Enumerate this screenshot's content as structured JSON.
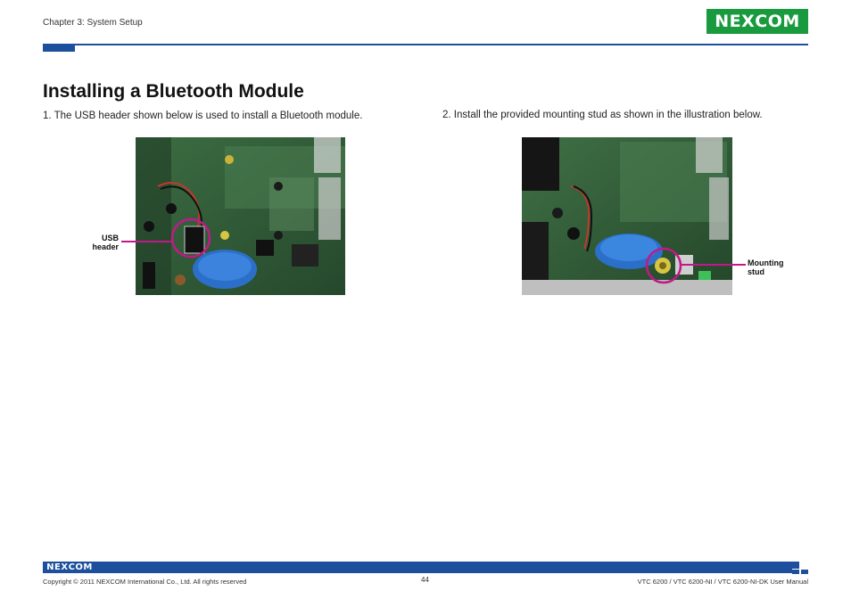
{
  "header": {
    "chapter": "Chapter 3: System Setup",
    "logo_text_a": "NE",
    "logo_text_x": "X",
    "logo_text_b": "COM",
    "brand_green": "#1a9a3e",
    "rule_color": "#1c4f9c"
  },
  "main": {
    "title": "Installing a Bluetooth Module",
    "step1": "1.  The USB header shown below is used to install a Bluetooth module.",
    "step2": "2.  Install the provided mounting stud as shown in the illustration below.",
    "callout1_line1": "USB",
    "callout1_line2": "header",
    "callout2_line1": "Mounting",
    "callout2_line2": "stud",
    "callout_color": "#c2188b"
  },
  "footer": {
    "logo_text_a": "NE",
    "logo_text_x": "X",
    "logo_text_b": "COM",
    "copyright": "Copyright © 2011 NEXCOM International Co., Ltd. All rights reserved",
    "page_number": "44",
    "manual_title": "VTC 6200 / VTC 6200-NI / VTC 6200-NI-DK User Manual"
  }
}
